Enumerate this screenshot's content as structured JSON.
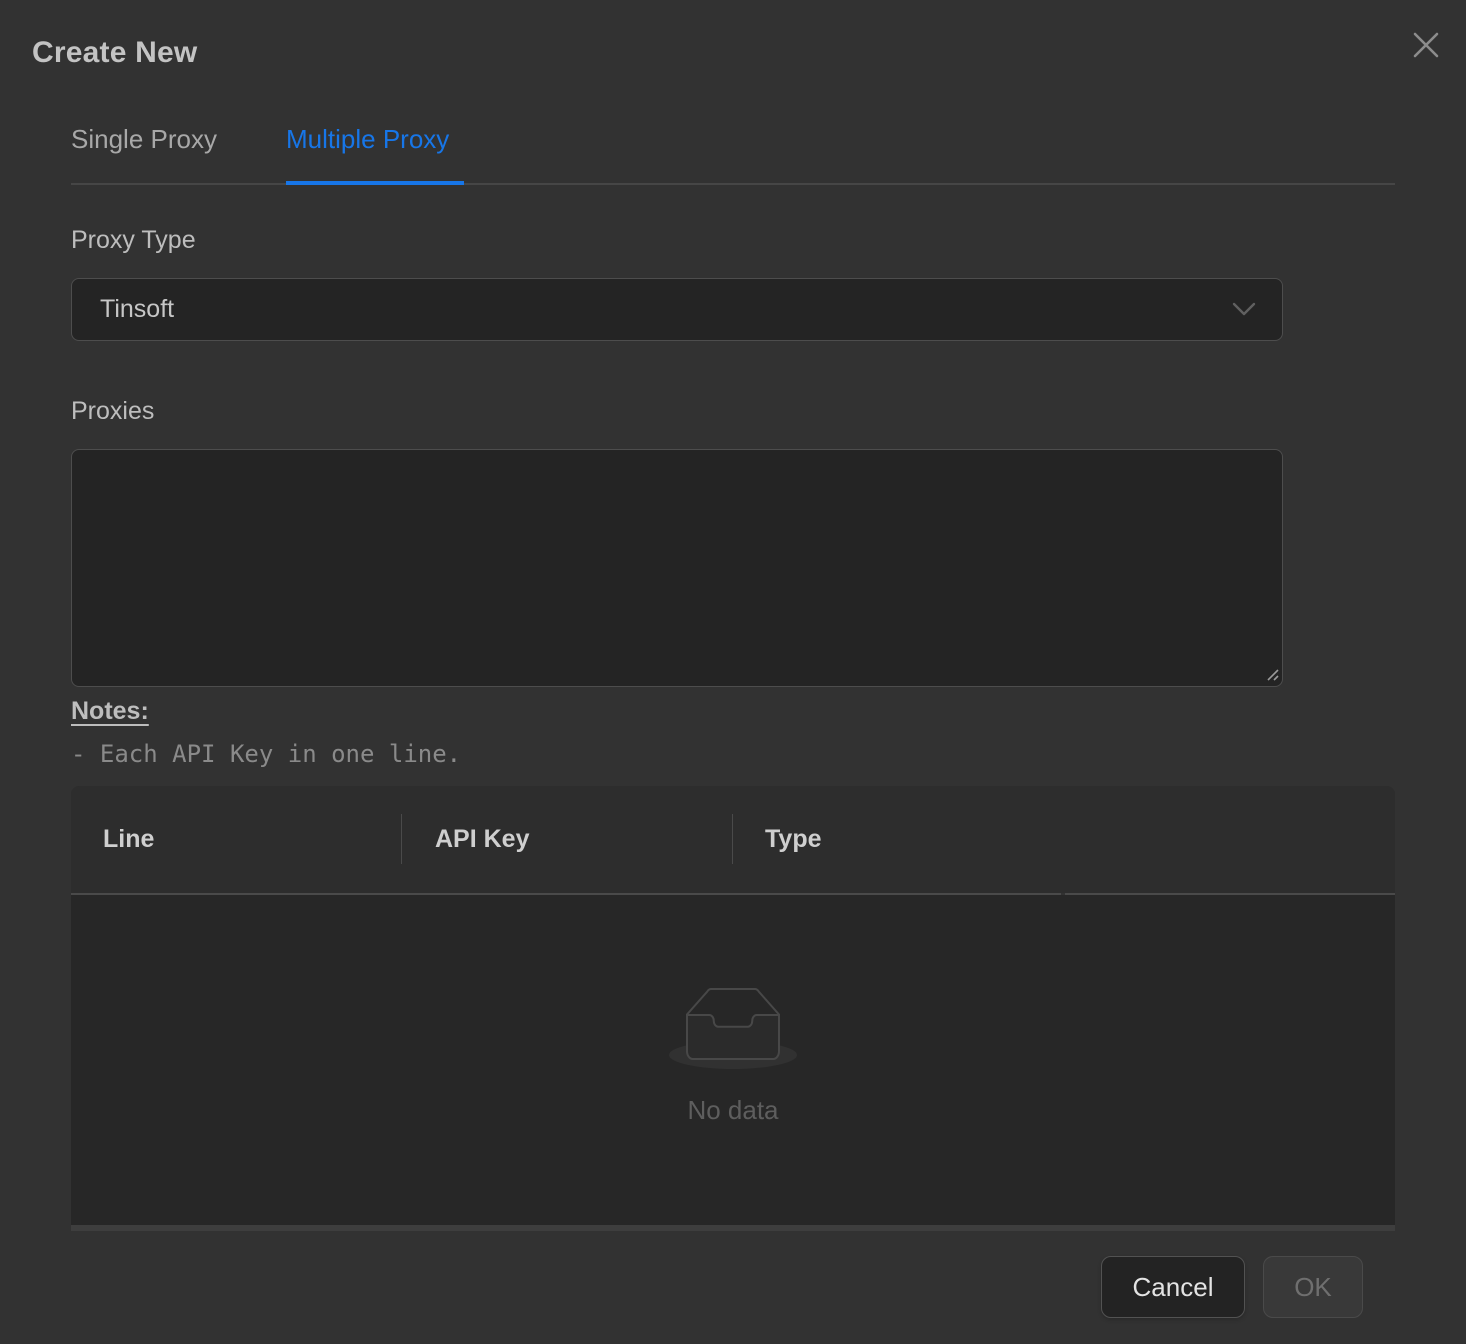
{
  "modal": {
    "title": "Create New"
  },
  "tabs": {
    "items": [
      {
        "label": "Single Proxy",
        "active": false
      },
      {
        "label": "Multiple Proxy",
        "active": true
      }
    ]
  },
  "form": {
    "proxy_type": {
      "label": "Proxy Type",
      "value": "Tinsoft"
    },
    "proxies": {
      "label": "Proxies",
      "value": ""
    },
    "notes": {
      "heading": "Notes:",
      "lines": [
        "- Each API Key in one line."
      ]
    }
  },
  "table": {
    "columns": [
      "Line",
      "API Key",
      "Type"
    ],
    "rows": [],
    "empty_text": "No data"
  },
  "footer": {
    "cancel_label": "Cancel",
    "ok_label": "OK",
    "ok_disabled": true
  },
  "icons": {
    "close": "close-icon",
    "chevron": "chevron-down-icon",
    "empty": "empty-inbox-icon",
    "resize": "resize-handle-icon"
  },
  "colors": {
    "accent_blue": "#1776e8",
    "modal_bg": "#323232",
    "input_bg": "#242424",
    "table_header_bg": "#2d2d2d",
    "table_body_bg": "#272727",
    "border": "#4d4d4d",
    "title_text": "#c3c3c3",
    "muted_text": "#8a8a8a",
    "empty_text": "#5e5e5e"
  }
}
